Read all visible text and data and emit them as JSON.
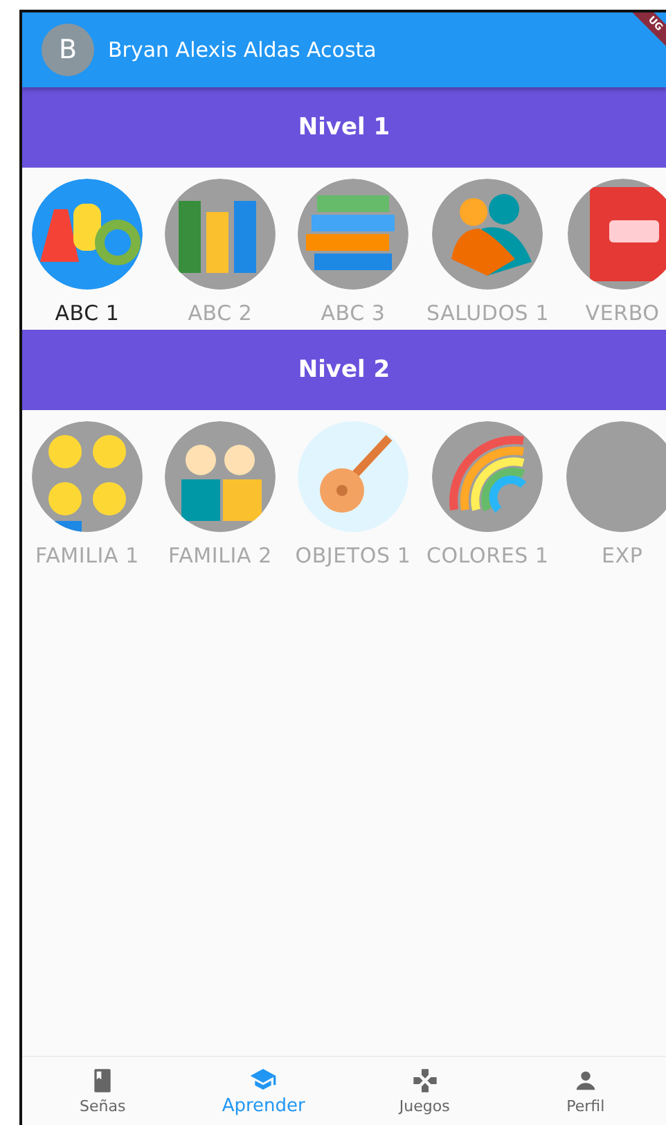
{
  "app_bar": {
    "avatar_letter": "B",
    "user_name": "Bryan Alexis Aldas Acosta",
    "debug_banner": "UG"
  },
  "levels": [
    {
      "title": "Nivel 1",
      "lessons": [
        {
          "label": "ABC 1",
          "kind": "abc",
          "unlocked": true
        },
        {
          "label": "ABC 2",
          "kind": "books-row",
          "unlocked": false
        },
        {
          "label": "ABC 3",
          "kind": "books-stack",
          "unlocked": false
        },
        {
          "label": "SALUDOS 1",
          "kind": "people",
          "unlocked": false
        },
        {
          "label": "VERBO",
          "kind": "letters",
          "unlocked": false
        }
      ]
    },
    {
      "title": "Nivel 2",
      "lessons": [
        {
          "label": "FAMILIA 1",
          "kind": "family",
          "unlocked": false
        },
        {
          "label": "FAMILIA 2",
          "kind": "grandparents",
          "unlocked": false
        },
        {
          "label": "OBJETOS 1",
          "kind": "guitar",
          "unlocked": false
        },
        {
          "label": "COLORES 1",
          "kind": "rainbow",
          "unlocked": false
        },
        {
          "label": "EXP",
          "kind": "blank",
          "unlocked": false
        }
      ]
    }
  ],
  "bottom_nav": [
    {
      "label": "Señas",
      "selected": false
    },
    {
      "label": "Aprender",
      "selected": true
    },
    {
      "label": "Juegos",
      "selected": false
    },
    {
      "label": "Perfil",
      "selected": false
    }
  ]
}
